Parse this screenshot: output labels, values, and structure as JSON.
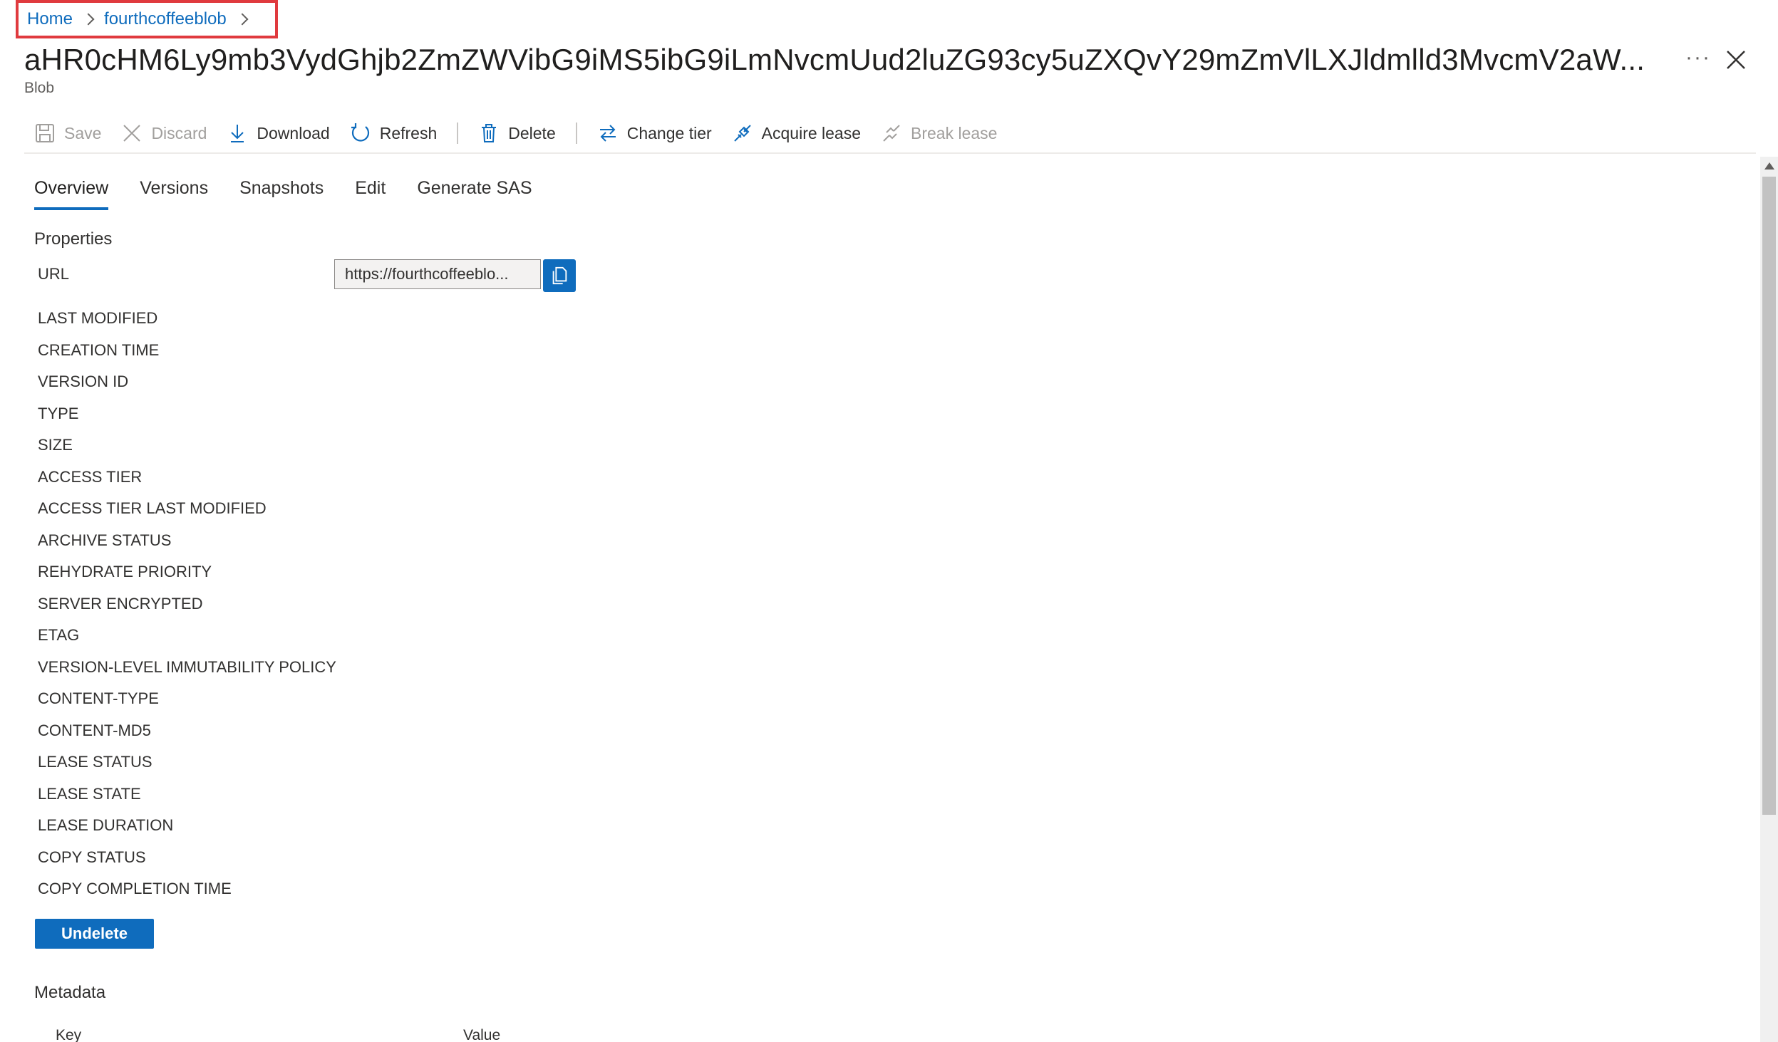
{
  "breadcrumb": {
    "home": "Home",
    "container": "fourthcoffeeblob"
  },
  "header": {
    "title": "aHR0cHM6Ly9mb3VydGhjb2ZmZWVibG9iMS5ibG9iLmNvcmUud2luZG93cy5uZXQvY29mZmVlLXJldmlld3MvcmV2aW...",
    "subtitle": "Blob",
    "more_label": "···"
  },
  "toolbar": {
    "save": "Save",
    "discard": "Discard",
    "download": "Download",
    "refresh": "Refresh",
    "delete": "Delete",
    "change_tier": "Change tier",
    "acquire_lease": "Acquire lease",
    "break_lease": "Break lease"
  },
  "tabs": [
    "Overview",
    "Versions",
    "Snapshots",
    "Edit",
    "Generate SAS"
  ],
  "properties": {
    "title": "Properties",
    "url_label": "URL",
    "url_value": "https://fourthcoffeeblo...",
    "labels": [
      "LAST MODIFIED",
      "CREATION TIME",
      "VERSION ID",
      "TYPE",
      "SIZE",
      "ACCESS TIER",
      "ACCESS TIER LAST MODIFIED",
      "ARCHIVE STATUS",
      "REHYDRATE PRIORITY",
      "SERVER ENCRYPTED",
      "ETAG",
      "VERSION-LEVEL IMMUTABILITY POLICY",
      "CONTENT-TYPE",
      "CONTENT-MD5",
      "LEASE STATUS",
      "LEASE STATE",
      "LEASE DURATION",
      "COPY STATUS",
      "COPY COMPLETION TIME"
    ]
  },
  "actions": {
    "undelete": "Undelete"
  },
  "metadata": {
    "title": "Metadata",
    "key_header": "Key",
    "value_header": "Value"
  },
  "colors": {
    "accent": "#0f6cbd",
    "highlight": "#e03a3e"
  }
}
